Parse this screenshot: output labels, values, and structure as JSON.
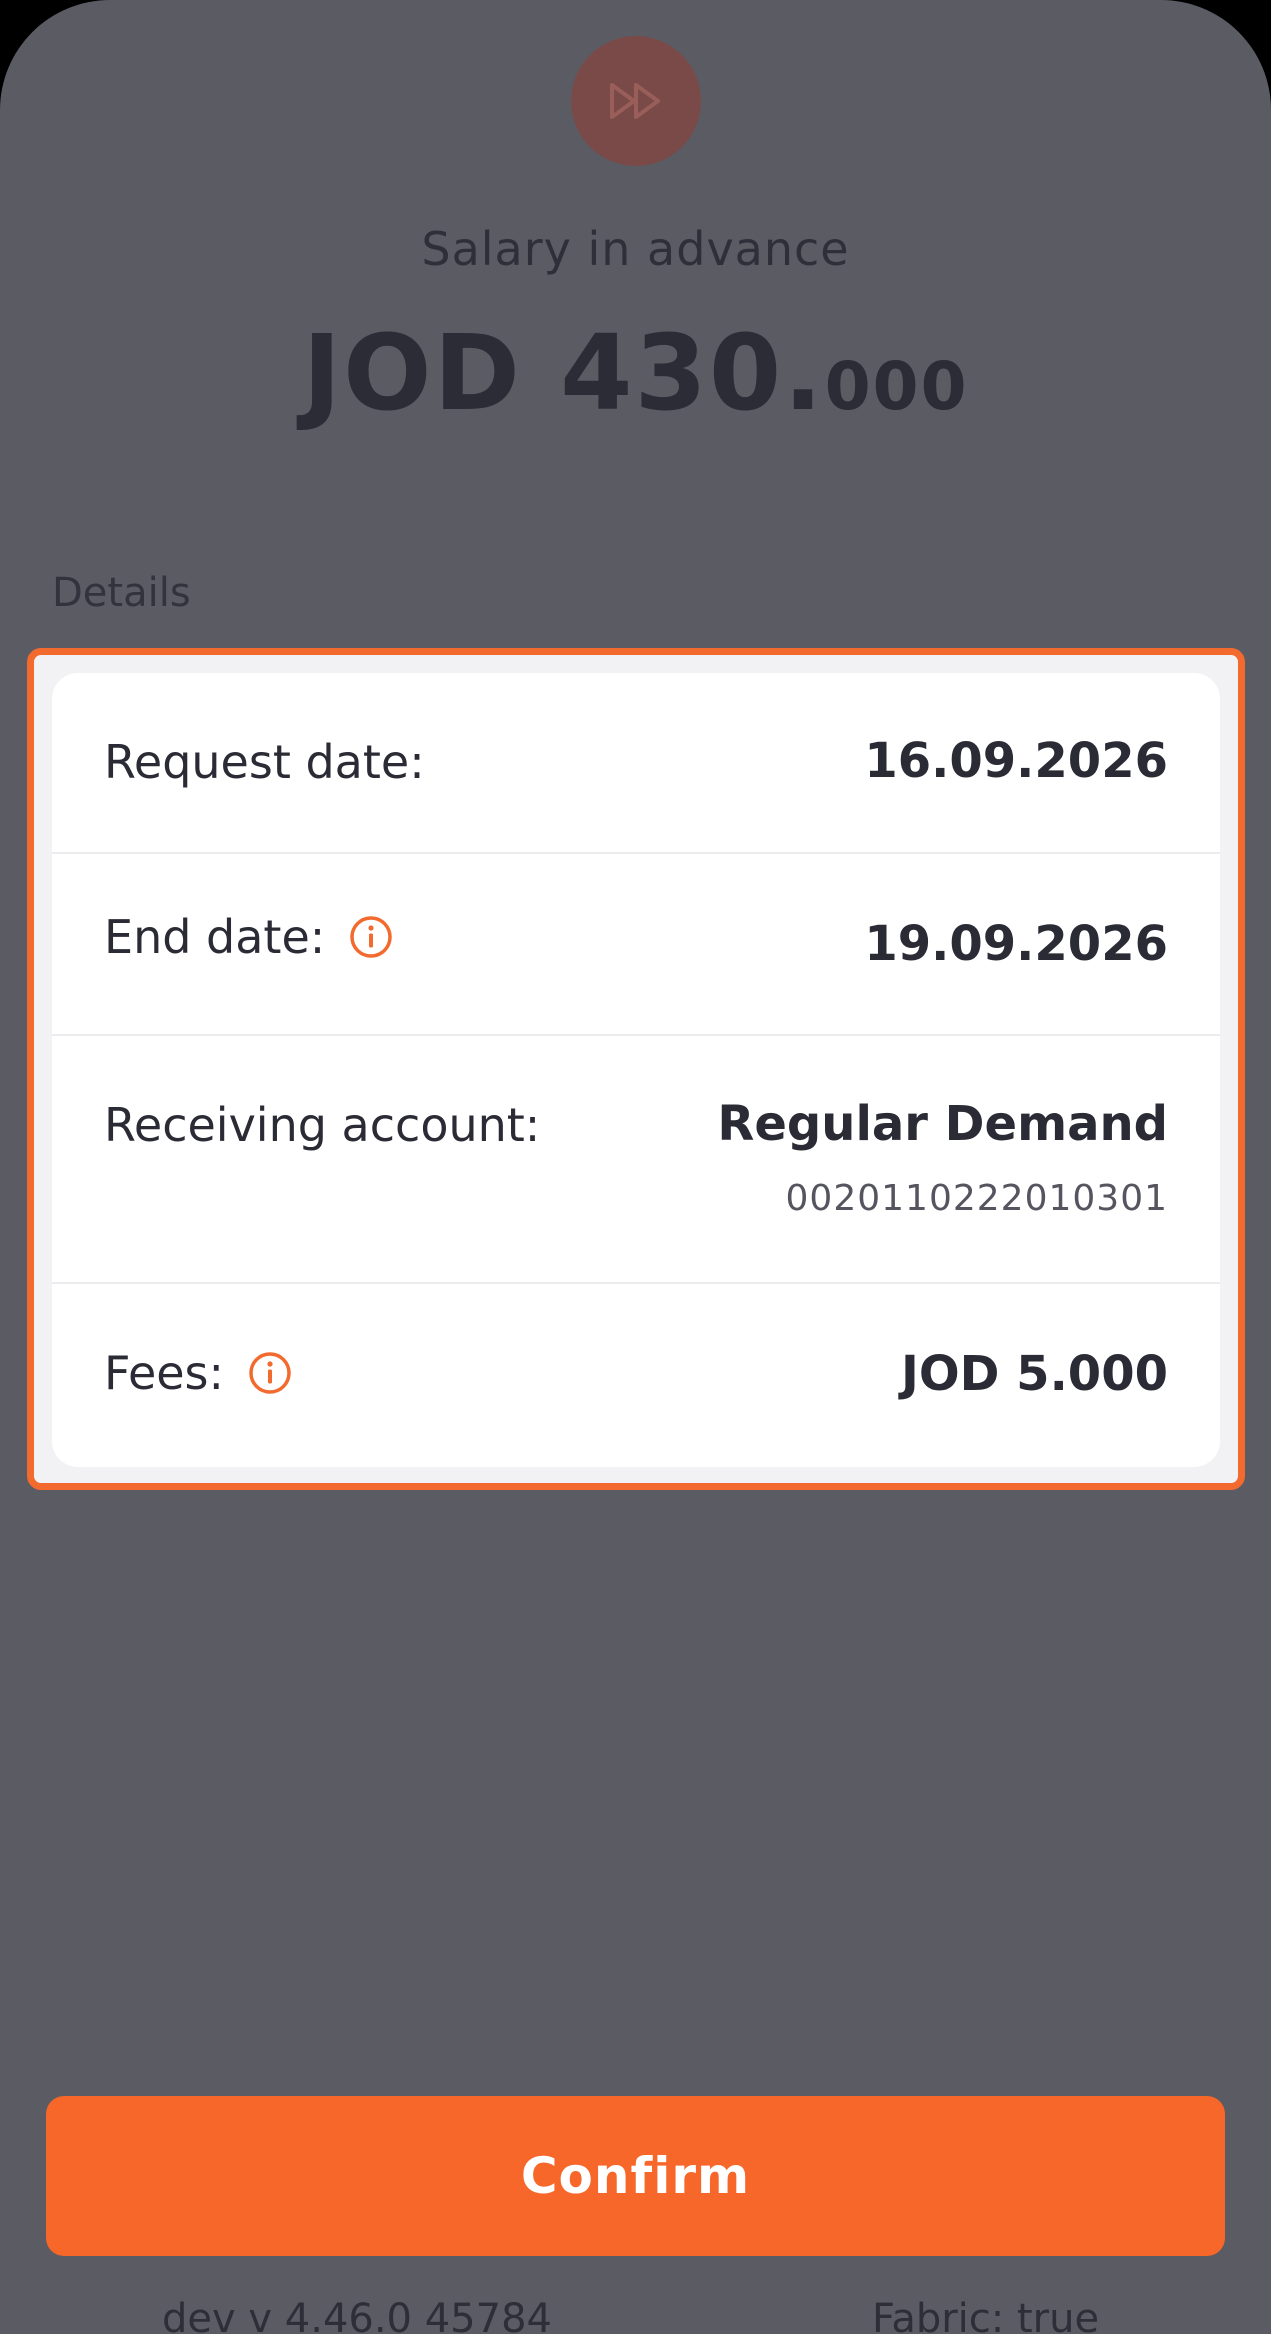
{
  "header": {
    "icon": "fast-forward-icon",
    "title": "Salary in advance",
    "amount_whole": "JOD 430.",
    "amount_decimal": "000"
  },
  "details": {
    "section_label": "Details",
    "rows": [
      {
        "label": "Request date:",
        "value": "16.09.2026"
      },
      {
        "label": "End date:",
        "value": "19.09.2026",
        "icon": "info-icon"
      },
      {
        "label": "Receiving account:",
        "value": "Regular Demand",
        "subvalue": "0020110222010301"
      },
      {
        "label": "Fees:",
        "value": "JOD 5.000",
        "icon": "info-icon"
      }
    ]
  },
  "footer": {
    "confirm_label": "Confirm",
    "version_text": "dev v 4.46.0 45784",
    "fabric_text": "Fabric: true"
  },
  "colors": {
    "accent": "#f7672a",
    "overlay": "#5b5b64",
    "card": "#ffffff"
  }
}
